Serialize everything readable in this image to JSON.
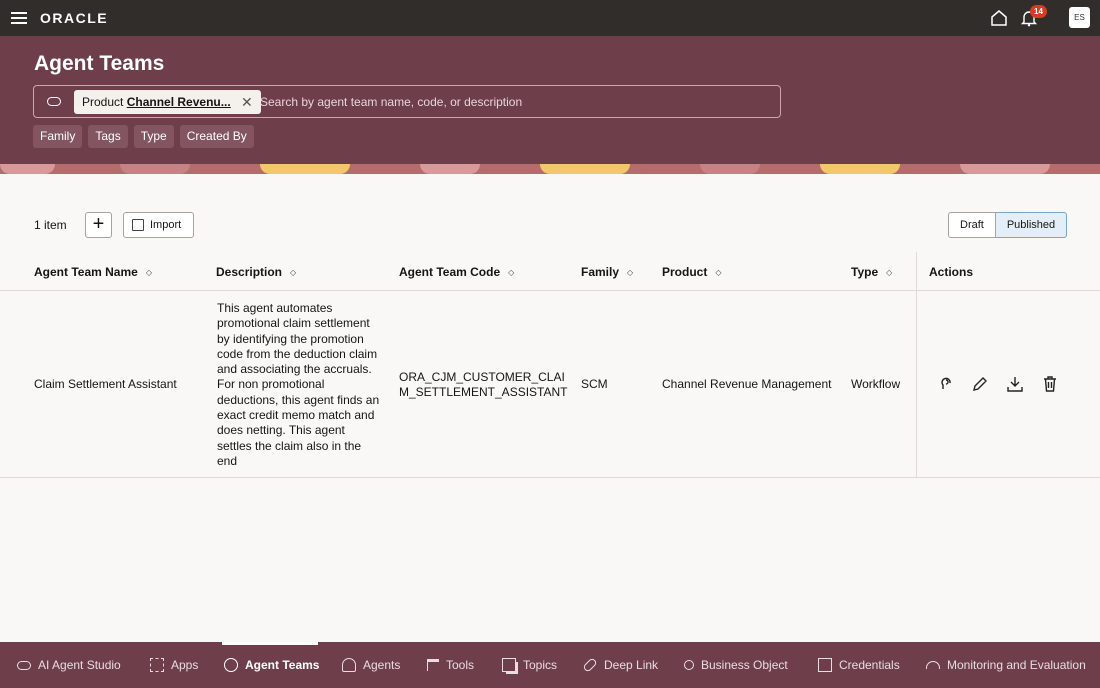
{
  "topbar": {
    "brand": "ORACLE",
    "notification_count": "14",
    "user_initials": "ES"
  },
  "header": {
    "title": "Agent Teams",
    "search": {
      "chip_label": "Product",
      "chip_value": "Channel Revenu...",
      "placeholder": "Search by agent team name, code, or description"
    },
    "filters": [
      "Family",
      "Tags",
      "Type",
      "Created By"
    ]
  },
  "toolbar": {
    "item_count": "1 item",
    "add_label": "+",
    "import_label": "Import",
    "draft_label": "Draft",
    "published_label": "Published"
  },
  "table": {
    "columns": [
      "Agent Team Name",
      "Description",
      "Agent Team Code",
      "Family",
      "Product",
      "Type",
      "Actions"
    ],
    "rows": [
      {
        "name": "Claim Settlement Assistant",
        "description": "This agent automates promotional claim settlement by identifying the promotion code from the deduction claim and associating the accruals. For non promotional deductions, this agent finds an exact credit memo match and does netting. This agent settles the claim also in the end",
        "code_line1": "ORA_CJM_CUSTOMER_CLAI",
        "code_line2": "M_SETTLEMENT_ASSISTANT",
        "family": "SCM",
        "product": "Channel Revenue Management",
        "type": "Workflow"
      }
    ]
  },
  "bottom_nav": {
    "items": [
      "AI Agent Studio",
      "Apps",
      "Agent Teams",
      "Agents",
      "Tools",
      "Topics",
      "Deep Link",
      "Business Object",
      "Credentials",
      "Monitoring and Evaluation"
    ],
    "active": "Agent Teams"
  }
}
